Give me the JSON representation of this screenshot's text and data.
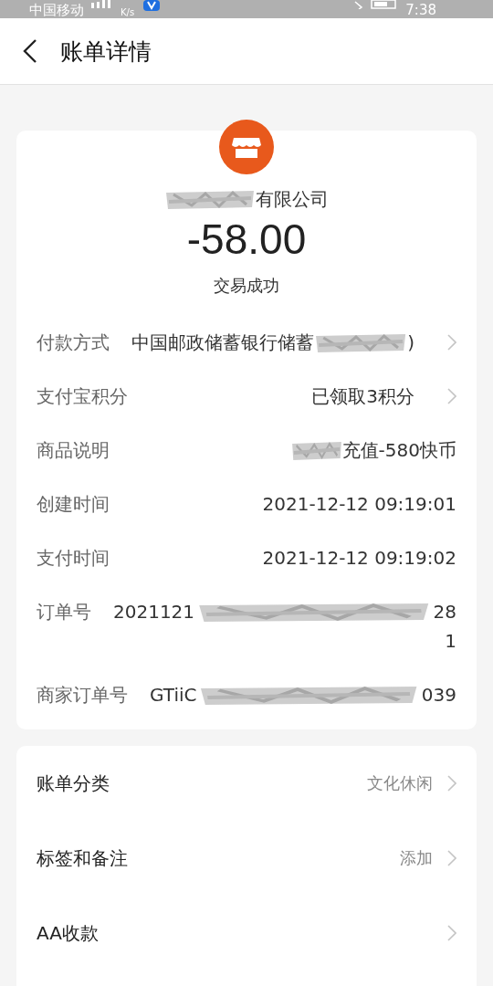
{
  "status_bar": {
    "carrier": "中国移动",
    "speed": "K/s",
    "time": "7:38"
  },
  "header": {
    "title": "账单详情"
  },
  "summary": {
    "merchant": [
      {
        "kind": "redacted"
      },
      {
        "kind": "text",
        "text": "有限公司"
      }
    ],
    "amount": "-58.00",
    "status": "交易成功"
  },
  "details": [
    {
      "label": "付款方式",
      "value": [
        {
          "kind": "text",
          "text": "中国邮政储蓄银行储蓄"
        },
        {
          "kind": "redacted"
        },
        {
          "kind": "text",
          "text": ")"
        }
      ],
      "chevron": true
    },
    {
      "label": "支付宝积分",
      "value": [
        {
          "kind": "text",
          "text": "已领取3积分"
        }
      ],
      "chevron": true
    },
    {
      "label": "商品说明",
      "value": [
        {
          "kind": "redacted"
        },
        {
          "kind": "text",
          "text": "充值-580快币"
        }
      ],
      "chevron": false
    },
    {
      "label": "创建时间",
      "value": [
        {
          "kind": "text",
          "text": "2021-12-12 09:19:01"
        }
      ],
      "chevron": false
    },
    {
      "label": "支付时间",
      "value": [
        {
          "kind": "text",
          "text": "2021-12-12 09:19:02"
        }
      ],
      "chevron": false
    },
    {
      "label": "订单号",
      "value": [
        {
          "kind": "text",
          "text": "2021121"
        },
        {
          "kind": "redacted"
        },
        {
          "kind": "text",
          "text": "28"
        },
        {
          "kind": "break"
        },
        {
          "kind": "text",
          "text": "1"
        }
      ],
      "chevron": false
    },
    {
      "label": "商家订单号",
      "value": [
        {
          "kind": "text",
          "text": "GTiiC"
        },
        {
          "kind": "redacted"
        },
        {
          "kind": "text",
          "text": "039"
        }
      ],
      "chevron": false
    }
  ],
  "options": [
    {
      "label": "账单分类",
      "value": "文化休闲",
      "chevron": true
    },
    {
      "label": "标签和备注",
      "value": "添加",
      "chevron": true
    },
    {
      "label": "AA收款",
      "chevron": true
    }
  ]
}
